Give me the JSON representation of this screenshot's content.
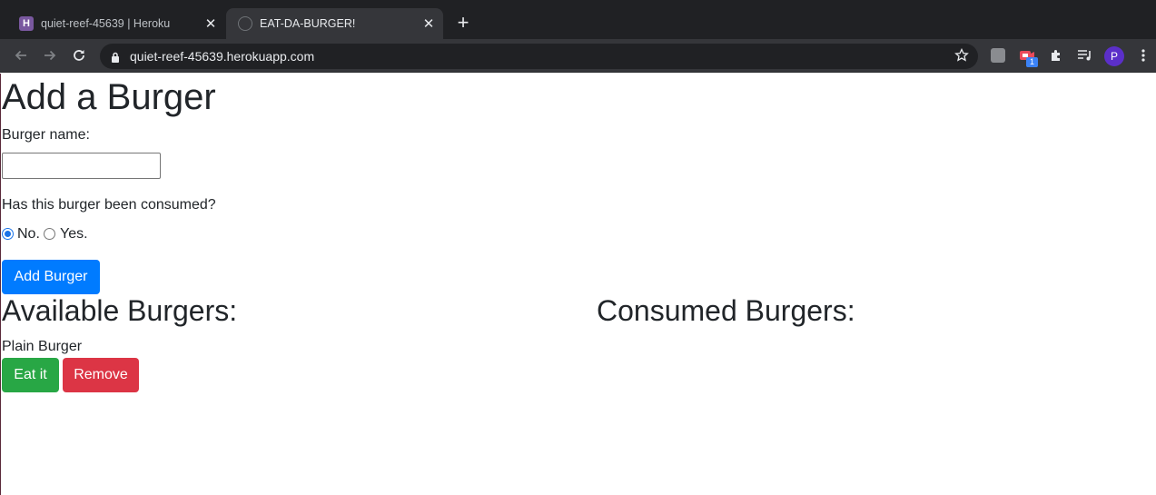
{
  "browser": {
    "tabs": [
      {
        "title": "quiet-reef-45639 | Heroku",
        "favicon": "heroku-icon",
        "active": false
      },
      {
        "title": "EAT-DA-BURGER!",
        "favicon": "globe-icon",
        "active": true
      }
    ],
    "new_tab_symbol": "+",
    "close_symbol": "✕",
    "url": "quiet-reef-45639.herokuapp.com",
    "extension_badge": "1",
    "profile_initial": "P"
  },
  "page": {
    "title": "Add a Burger",
    "form": {
      "name_label": "Burger name:",
      "name_value": "",
      "consumed_question": "Has this burger been consumed?",
      "option_no": "No.",
      "option_yes": "Yes.",
      "selected_option": "No.",
      "submit_label": "Add Burger"
    },
    "available": {
      "heading": "Available Burgers:",
      "items": [
        {
          "name": "Plain Burger",
          "eat_label": "Eat it",
          "remove_label": "Remove"
        }
      ]
    },
    "consumed": {
      "heading": "Consumed Burgers:",
      "items": []
    }
  },
  "colors": {
    "primary": "#007bff",
    "success": "#28a745",
    "danger": "#dc3545",
    "text": "#212529"
  }
}
